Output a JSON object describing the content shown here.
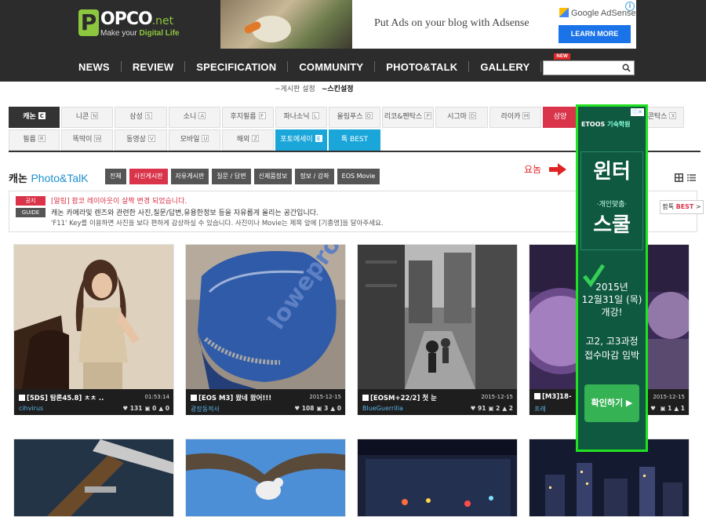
{
  "logo": {
    "letter": "P",
    "name": "OPCO",
    "suffix": ".net",
    "tagline_pre": "Make your ",
    "tagline_em": "Digital Life"
  },
  "top_ad": {
    "text": "Put Ads on your blog with Adsense",
    "brand": "Google AdSense",
    "button": "LEARN MORE",
    "info": "i"
  },
  "nav": [
    {
      "label": "NEWS"
    },
    {
      "label": "REVIEW"
    },
    {
      "label": "SPECIFICATION"
    },
    {
      "label": "COMMUNITY"
    },
    {
      "label": "PHOTO&TALK"
    },
    {
      "label": "GALLERY"
    },
    {
      "label": "EVENT",
      "badge": "NEW"
    }
  ],
  "search": {
    "placeholder": ""
  },
  "sublinks": {
    "board_settings": "~게시판 설정",
    "skin_settings": "~스킨설정"
  },
  "categories_row1": [
    {
      "label": "캐논",
      "key": "C",
      "w": 65,
      "style": "active"
    },
    {
      "label": "니콘",
      "key": "N",
      "w": 66
    },
    {
      "label": "삼성",
      "key": "S",
      "w": 67
    },
    {
      "label": "소니",
      "key": "A",
      "w": 66
    },
    {
      "label": "후지필름",
      "key": "F",
      "w": 66
    },
    {
      "label": "파나소닉",
      "key": "L",
      "w": 66
    },
    {
      "label": "올림푸스",
      "key": "O",
      "w": 66
    },
    {
      "label": "리코&펜탁스",
      "key": "P",
      "w": 66
    },
    {
      "label": "시그마",
      "key": "D",
      "w": 67
    },
    {
      "label": "라이카",
      "key": "M",
      "w": 66
    },
    {
      "label": "삼양",
      "key": "",
      "w": 44,
      "style": "red"
    },
    {
      "label": "",
      "key": "",
      "w": 76
    },
    {
      "label": "콘탁스",
      "key": "X",
      "w": 56
    }
  ],
  "categories_row2": [
    {
      "label": "필름",
      "key": "R",
      "w": 65
    },
    {
      "label": "똑딱이",
      "key": "W",
      "w": 66
    },
    {
      "label": "동영상",
      "key": "V",
      "w": 67
    },
    {
      "label": "모바일",
      "key": "U",
      "w": 66
    },
    {
      "label": "해외",
      "key": "Z",
      "w": 66
    },
    {
      "label": "포토에세이",
      "key": "E",
      "w": 66,
      "style": "cyan"
    },
    {
      "label": "톡 BEST",
      "key": "",
      "w": 66,
      "style": "cyan"
    }
  ],
  "board": {
    "title": "캐논",
    "subtitle": "Photo&TalK"
  },
  "filters": [
    {
      "label": "전체"
    },
    {
      "label": "사진게시판",
      "active": true
    },
    {
      "label": "자유게시판"
    },
    {
      "label": "질문 / 답변"
    },
    {
      "label": "신제품정보"
    },
    {
      "label": "정보 / 강좌"
    },
    {
      "label": "EOS Movie"
    }
  ],
  "annotation": {
    "label": "요놈"
  },
  "notice": {
    "badge1": "공지",
    "badge2": "GUIDE",
    "line1": "[알림] 팝코 레이아웃이 살짝 변경 되었습니다.",
    "line2": "캐논 카메라및 렌즈와 관련한 사진,질문/답변,유용한정보 등을 자유롭게 올리는 공간입니다.",
    "line3": "'F11' Key를 이용하면 사진을 보다 편하게 감상하실 수 있습니다. 사진이나 Movie는 제목 앞에 [기종명]을 달아주세요.",
    "tipbest_pre": "팝톡 ",
    "tipbest_red": "BEST",
    "tipbest_arrow": " >"
  },
  "cards": [
    {
      "title": "[5DS] 탐론45.8] ㅊㅊ ..",
      "date": "01:53:14",
      "user": "cihvirus",
      "hearts": "131",
      "comments": "0",
      "likes": "0"
    },
    {
      "title": "[EOS M3] 왔네 왔어!!!",
      "date": "2015-12-15",
      "user": "광장동적사",
      "hearts": "108",
      "comments": "3",
      "likes": "0"
    },
    {
      "title": "[EOSM+22/2] 첫 눈",
      "date": "2015-12-15",
      "user": "BlueGuerrilla",
      "hearts": "91",
      "comments": "2",
      "likes": "2"
    },
    {
      "title": "[M3]18-",
      "date": "2015-12-15",
      "user": "프레",
      "hearts": "",
      "comments": "1",
      "likes": "1"
    }
  ],
  "side_ad": {
    "adchoice": "ⓘ✕",
    "brand_pre": "ETOOS ",
    "brand_em": "기숙학원",
    "big1": "윈터",
    "sub1": "·개인맞춤·",
    "big2": "스쿨",
    "date1a": "2015년",
    "date1b": "12월31일 (목)",
    "date1c": "개강!",
    "date2a": "고2, 고3과정",
    "date2b": "접수마감 임박",
    "cta": "확인하기 ▶"
  },
  "colors": {
    "header": "#2c2c2c",
    "accent_red": "#d9344a",
    "accent_blue": "#1d8fce",
    "accent_cyan": "#1aa6d9",
    "logo_green": "#8dc63f",
    "highlight_box": "#22e022"
  }
}
